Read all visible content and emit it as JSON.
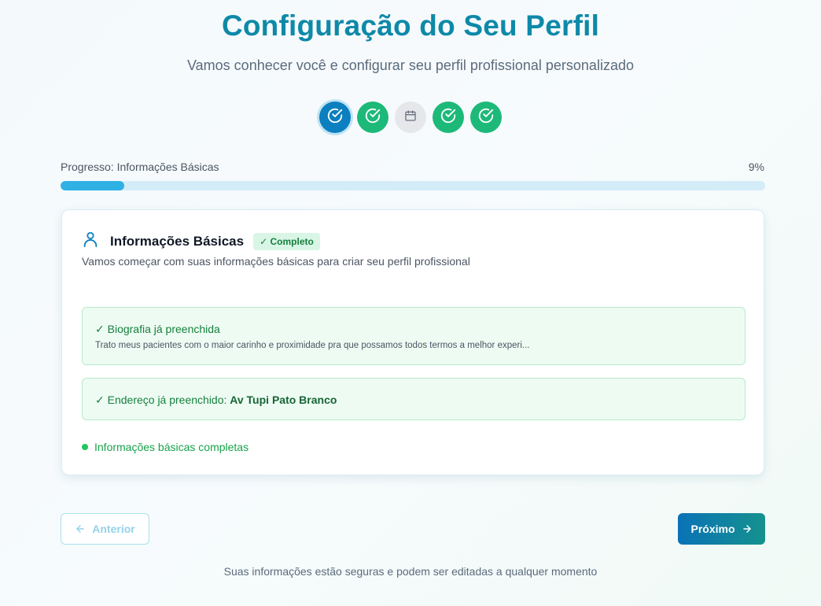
{
  "header": {
    "title": "Configuração do Seu Perfil",
    "subtitle": "Vamos conhecer você e configurar seu perfil profissional personalizado"
  },
  "steps": [
    {
      "icon": "check-circle-icon",
      "state": "active"
    },
    {
      "icon": "check-circle-icon",
      "state": "done"
    },
    {
      "icon": "calendar-icon",
      "state": "pending"
    },
    {
      "icon": "check-circle-icon",
      "state": "done"
    },
    {
      "icon": "check-circle-icon",
      "state": "done"
    }
  ],
  "progress": {
    "label": "Progresso: Informações Básicas",
    "percent_text": "9%",
    "value": 0.09
  },
  "card": {
    "icon": "user-icon",
    "title": "Informações Básicas",
    "badge": "✓ Completo",
    "description": "Vamos começar com suas informações básicas para criar seu perfil profissional",
    "bio": {
      "label": "✓ Biografia já preenchida",
      "text": "Trato meus pacientes com o maior carinho e proximidade pra que possamos todos termos a melhor experi..."
    },
    "address": {
      "label": "✓ Endereço já preenchido: ",
      "value": "Av Tupi Pato Branco"
    },
    "status": "Informações básicas completas"
  },
  "nav": {
    "prev_label": "Anterior",
    "next_label": "Próximo"
  },
  "footer": {
    "note": "Suas informações estão seguras e podem ser editadas a qualquer momento"
  },
  "colors": {
    "title": "#0e89a8",
    "active_step": "#0b7fbf",
    "done_step": "#1db979",
    "progress_fill": "#2fb1e4",
    "success_text": "#15803d"
  }
}
